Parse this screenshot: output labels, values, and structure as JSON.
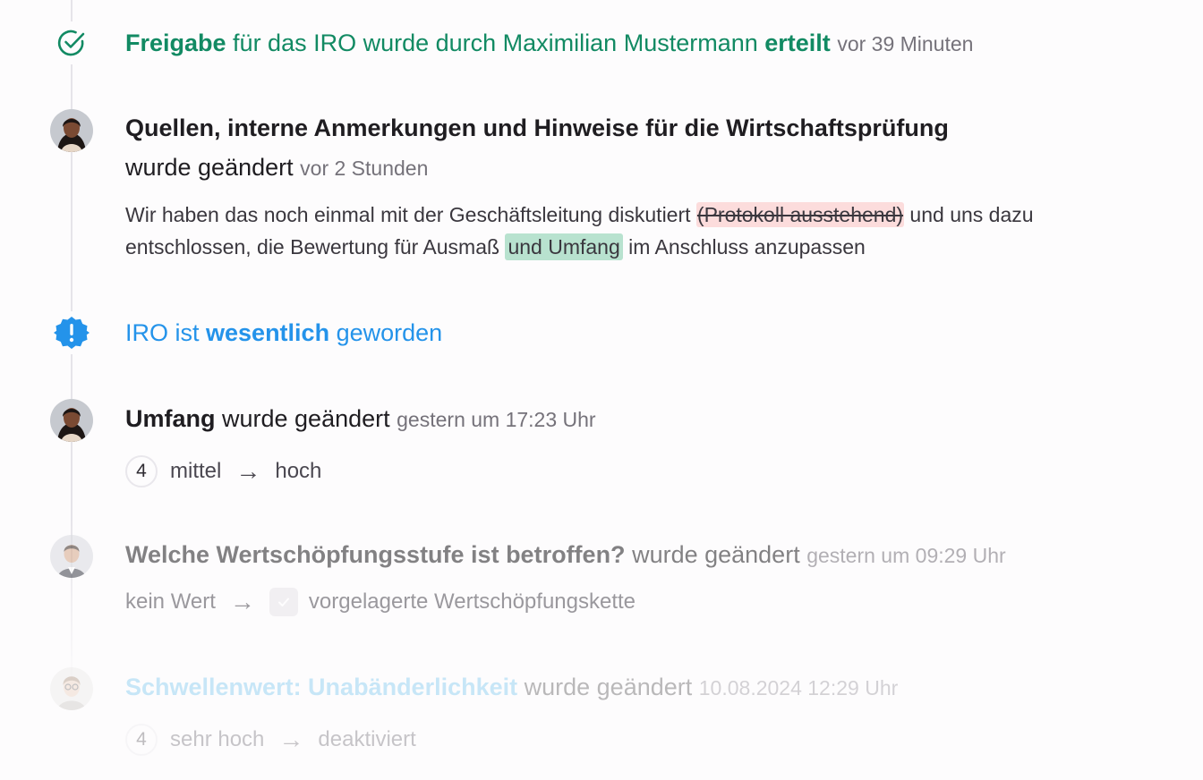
{
  "entries": [
    {
      "icon": "check-circle-icon",
      "prefix": "Freigabe",
      "middle": " für das IRO wurde durch Maximilian Mustermann ",
      "suffix": "erteilt",
      "time": "vor 39 Minuten"
    },
    {
      "icon": "avatar-woman",
      "title": "Quellen, interne Anmerkungen und Hinweise für die Wirtschaftsprüfung",
      "action": "wurde geändert",
      "time": "vor 2 Stunden",
      "text_1": "Wir haben das noch einmal mit der Geschäftsleitung diskutiert ",
      "deleted": "(Protokoll ausstehend)",
      "text_2": " und uns dazu",
      "text_3": "entschlossen, die Bewertung für Ausmaß ",
      "inserted": "und Umfang",
      "text_4": " im Anschluss anzupassen"
    },
    {
      "icon": "alert-badge-icon",
      "prefix": "IRO ist ",
      "highlight": "wesentlich",
      "suffix": " geworden"
    },
    {
      "icon": "avatar-woman",
      "field": "Umfang",
      "action": " wurde geändert ",
      "time": "gestern um 17:23 Uhr",
      "badge": "4",
      "from": "mittel",
      "to": "hoch"
    },
    {
      "icon": "avatar-man",
      "field": "Welche Wertschöpfungsstufe ist betroffen?",
      "action": " wurde geändert ",
      "time": "gestern um 09:29 Uhr",
      "from": "kein Wert",
      "to": "vorgelagerte Wertschöpfungskette"
    },
    {
      "icon": "avatar-man-glasses",
      "field": "Schwellenwert: Unabänderlichkeit",
      "action": " wurde geändert ",
      "time": "10.08.2024 12:29 Uhr",
      "badge": "4",
      "from": "sehr hoch",
      "to": "deaktiviert"
    }
  ],
  "arrow": "→",
  "colors": {
    "approve_green": "#128a63",
    "material_blue": "#2493ea",
    "deleted_bg": "#fcdcdc",
    "inserted_bg": "#b8e2cf",
    "link_blue_faded": "#7fc8ef"
  }
}
